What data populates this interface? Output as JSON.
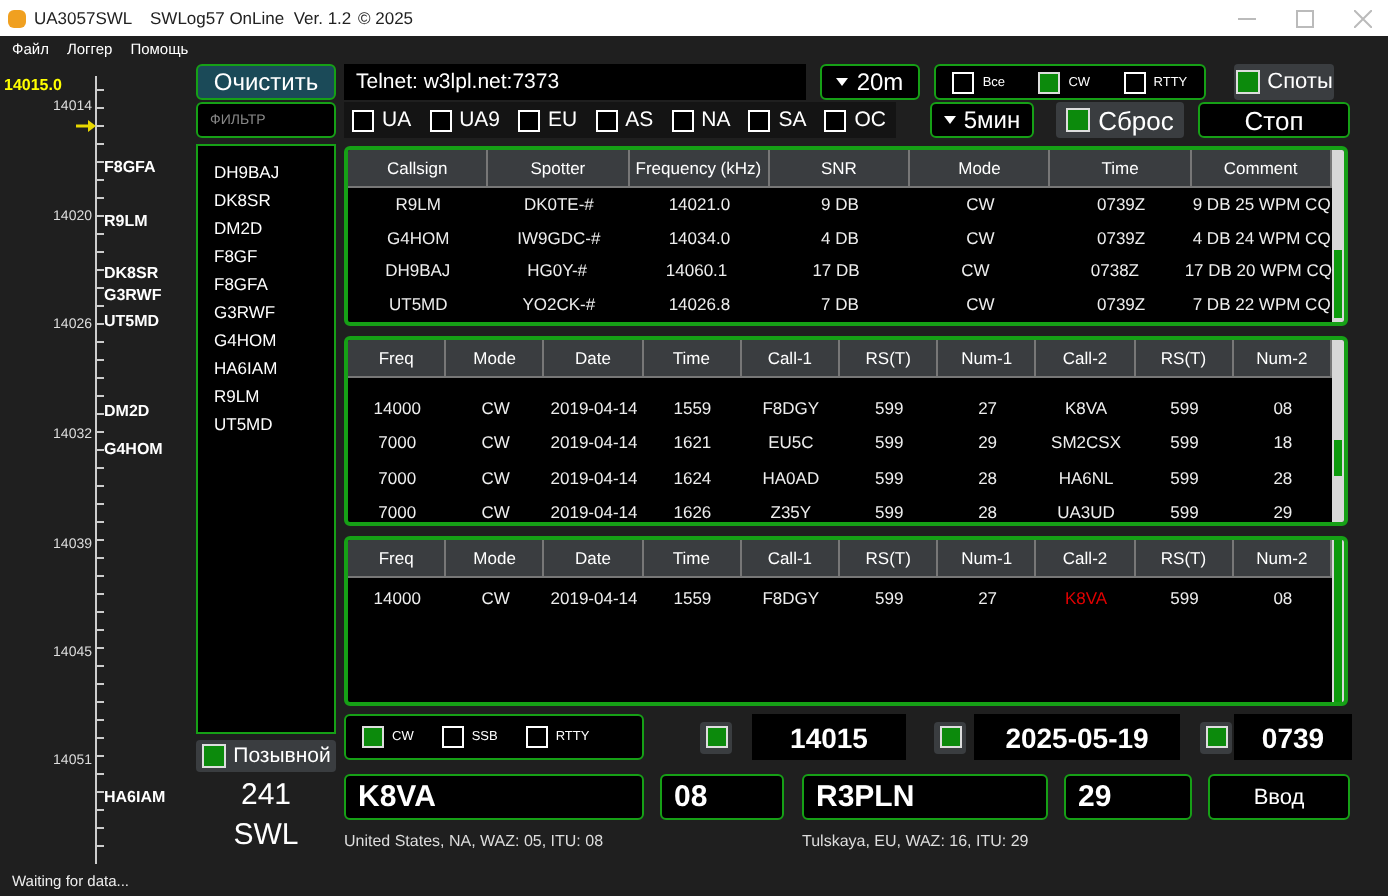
{
  "window": {
    "title": "UA3057SWL",
    "app_title": "SWLog57 OnLine  Ver. 1.2",
    "copyright": "© 2025"
  },
  "menu": [
    "Файл",
    "Логгер",
    "Помощь"
  ],
  "band_scale": {
    "current": "14015.0",
    "ticks": [
      "14014",
      "14020",
      "14026",
      "14032",
      "14039",
      "14045",
      "14051"
    ],
    "spots": [
      "F8GFA",
      "R9LM",
      "DK8SR",
      "G3RWF",
      "UT5MD",
      "DM2D",
      "G4HOM",
      "HA6IAM"
    ]
  },
  "clear_button": "Очистить",
  "filter": {
    "placeholder": "ФИЛЬТР"
  },
  "calls_list": [
    "DH9BAJ",
    "DK8SR",
    "DM2D",
    "F8GF",
    "F8GFA",
    "G3RWF",
    "G4HOM",
    "HA6IAM",
    "R9LM",
    "UT5MD"
  ],
  "callsign_toggle": {
    "label": "Позывной",
    "checked": true
  },
  "count": "241",
  "role": "SWL",
  "telnet": {
    "value": "Telnet: w3lpl.net:7373"
  },
  "band": "20m",
  "mode_filter": [
    {
      "label": "Все",
      "checked": false
    },
    {
      "label": "CW",
      "checked": true
    },
    {
      "label": "RTTY",
      "checked": false
    }
  ],
  "spots_toggle": {
    "label": "Споты",
    "checked": true
  },
  "regions": [
    {
      "label": "UA",
      "checked": false
    },
    {
      "label": "UA9",
      "checked": false
    },
    {
      "label": "EU",
      "checked": false
    },
    {
      "label": "AS",
      "checked": false
    },
    {
      "label": "NA",
      "checked": false
    },
    {
      "label": "SA",
      "checked": false
    },
    {
      "label": "OC",
      "checked": false
    }
  ],
  "interval": "5мин",
  "reset_toggle": {
    "label": "Сброс",
    "checked": true
  },
  "stop_button": "Стоп",
  "spots_table": {
    "columns": [
      "Callsign",
      "Spotter",
      "Frequency (kHz)",
      "SNR",
      "Mode",
      "Time",
      "Comment"
    ],
    "rows": [
      [
        "R9LM",
        "DK0TE-#",
        "14021.0",
        "9 DB",
        "CW",
        "0739Z",
        "9 DB 25 WPM CQ"
      ],
      [
        "G4HOM",
        "IW9GDC-#",
        "14034.0",
        "4 DB",
        "CW",
        "0739Z",
        "4 DB 24 WPM CQ"
      ],
      [
        "DH9BAJ",
        "HG0Y-#",
        "14060.1",
        "17 DB",
        "CW",
        "0738Z",
        "17 DB 20 WPM CQ"
      ],
      [
        "UT5MD",
        "YO2CK-#",
        "14026.8",
        "7 DB",
        "CW",
        "0739Z",
        "7 DB 22 WPM CQ"
      ]
    ]
  },
  "log_table": {
    "columns": [
      "Freq",
      "Mode",
      "Date",
      "Time",
      "Call-1",
      "RS(T)",
      "Num-1",
      "Call-2",
      "RS(T)",
      "Num-2"
    ],
    "rows": [
      [
        "14000",
        "CW",
        "2019-04-14",
        "1559",
        "F8DGY",
        "599",
        "27",
        "K8VA",
        "599",
        "08"
      ],
      [
        "7000",
        "CW",
        "2019-04-14",
        "1621",
        "EU5C",
        "599",
        "29",
        "SM2CSX",
        "599",
        "18"
      ],
      [
        "7000",
        "CW",
        "2019-04-14",
        "1624",
        "HA0AD",
        "599",
        "28",
        "HA6NL",
        "599",
        "28"
      ],
      [
        "7000",
        "CW",
        "2019-04-14",
        "1626",
        "Z35Y",
        "599",
        "28",
        "UA3UD",
        "599",
        "29"
      ]
    ]
  },
  "match_table": {
    "columns": [
      "Freq",
      "Mode",
      "Date",
      "Time",
      "Call-1",
      "RS(T)",
      "Num-1",
      "Call-2",
      "RS(T)",
      "Num-2"
    ],
    "rows": [
      {
        "cells": [
          {
            "text": "14000",
            "alert": false
          },
          {
            "text": "CW",
            "alert": false
          },
          {
            "text": "2019-04-14",
            "alert": false
          },
          {
            "text": "1559",
            "alert": false
          },
          {
            "text": "F8DGY",
            "alert": false
          },
          {
            "text": "599",
            "alert": false
          },
          {
            "text": "27",
            "alert": false
          },
          {
            "text": "K8VA",
            "alert": true
          },
          {
            "text": "599",
            "alert": false
          },
          {
            "text": "08",
            "alert": false
          }
        ]
      }
    ]
  },
  "log_modes": [
    {
      "label": "CW",
      "checked": true
    },
    {
      "label": "SSB",
      "checked": false
    },
    {
      "label": "RTTY",
      "checked": false
    }
  ],
  "frequency": {
    "checked": true,
    "value": "14015"
  },
  "date": {
    "checked": true,
    "value": "2025-05-19"
  },
  "time": {
    "checked": true,
    "value": "0739"
  },
  "entry": {
    "call_1": "K8VA",
    "num_1": "08",
    "call_2": "R3PLN",
    "num_2": "29"
  },
  "enter_button": "Ввод",
  "info_1": "United States, NA, WAZ: 05, ITU: 08",
  "info_2": "Tulskaya, EU, WAZ: 16, ITU: 29",
  "status": "Waiting for data..."
}
